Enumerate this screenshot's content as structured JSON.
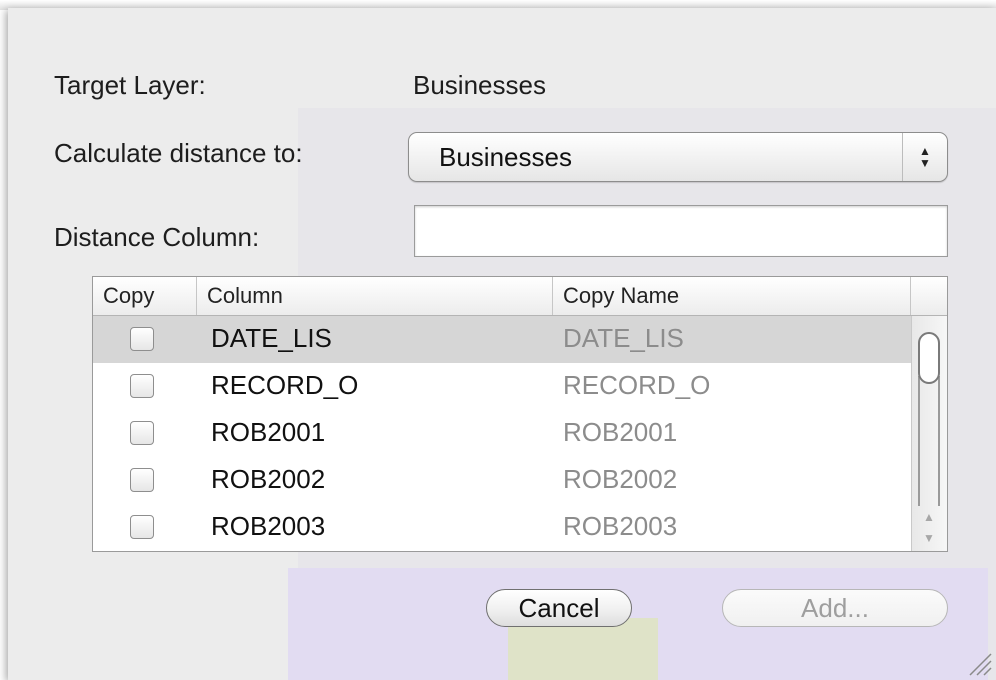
{
  "target_layer": {
    "label": "Target Layer:",
    "value": "Businesses"
  },
  "calculate_distance": {
    "label": "Calculate distance to:",
    "selected": "Businesses"
  },
  "distance_column": {
    "label": "Distance Column:",
    "value": ""
  },
  "table": {
    "headers": {
      "copy": "Copy",
      "column": "Column",
      "copy_name": "Copy Name"
    },
    "rows": [
      {
        "checked": false,
        "column": "DATE_LIS",
        "copy_name": "DATE_LIS",
        "selected": true
      },
      {
        "checked": false,
        "column": "RECORD_O",
        "copy_name": "RECORD_O",
        "selected": false
      },
      {
        "checked": false,
        "column": "ROB2001",
        "copy_name": "ROB2001",
        "selected": false
      },
      {
        "checked": false,
        "column": "ROB2002",
        "copy_name": "ROB2002",
        "selected": false
      },
      {
        "checked": false,
        "column": "ROB2003",
        "copy_name": "ROB2003",
        "selected": false
      }
    ]
  },
  "buttons": {
    "cancel": "Cancel",
    "add": "Add..."
  }
}
